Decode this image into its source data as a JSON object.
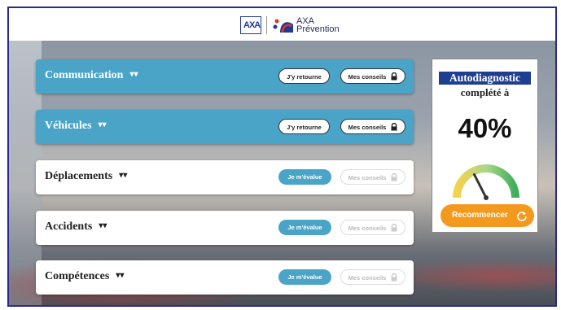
{
  "header": {
    "logo_text": "AXA",
    "brand_line1": "AXA",
    "brand_line2": "Prévention"
  },
  "labels": {
    "jy_retourne": "J'y retourne",
    "mes_conseils": "Mes conseils",
    "je_mevalue": "Je m'évalue"
  },
  "categories": [
    {
      "title": "Communication",
      "status": "completed"
    },
    {
      "title": "Véhicules",
      "status": "completed"
    },
    {
      "title": "Déplacements",
      "status": "not-started"
    },
    {
      "title": "Accidents",
      "status": "not-started"
    },
    {
      "title": "Compétences",
      "status": "not-started"
    }
  ],
  "panel": {
    "title": "Autodiagnostic",
    "subtitle": "complété à",
    "percent_text": "40%",
    "progress": 0.4,
    "restart_label": "Recommencer"
  },
  "colors": {
    "blue": "#4aa4c7",
    "navy": "#1e3f90",
    "orange": "#f39a1e"
  }
}
